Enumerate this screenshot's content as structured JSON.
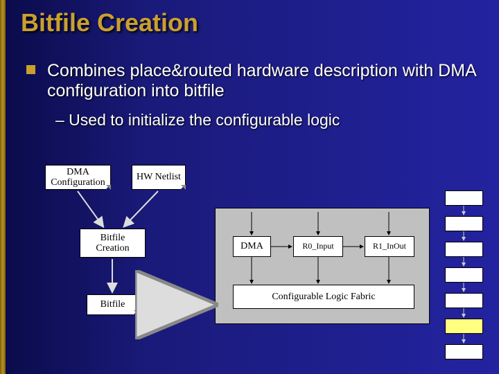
{
  "title": "Bitfile Creation",
  "bullet1": "Combines place&routed hardware description with DMA configuration into bitfile",
  "sub1": "– Used to initialize the configurable logic",
  "left_diagram": {
    "dma_config": "DMA\nConfiguration",
    "hw_netlist": "HW Netlist",
    "bitfile_creation": "Bitfile\nCreation",
    "bitfile": "Bitfile"
  },
  "right_diagram": {
    "dma": "DMA",
    "r0": "R0_Input",
    "r1": "R1_InOut",
    "fabric": "Configurable Logic Fabric"
  }
}
